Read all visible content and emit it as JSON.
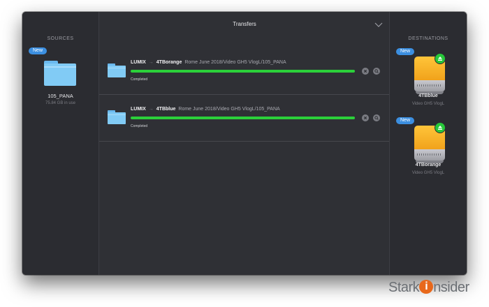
{
  "window": {
    "title": "Transfers",
    "sources_header": "SOURCES",
    "destinations_header": "DESTINATIONS"
  },
  "source": {
    "badge": "New",
    "name": "105_PANA",
    "usage": "75.84 GB in use"
  },
  "transfers": [
    {
      "source": "LUMIX",
      "arrow": "→",
      "destination": "4TBorange",
      "path": "Rome June 2018/Video GH5 VlogL/105_PANA",
      "status": "Completed",
      "progress": 1.0
    },
    {
      "source": "LUMIX",
      "arrow": "→",
      "destination": "4TBblue",
      "path": "Rome June 2018/Video GH5 VlogL/105_PANA",
      "status": "Completed",
      "progress": 1.0
    }
  ],
  "destinations": [
    {
      "badge": "New",
      "name": "4TBblue",
      "subtitle": "Video GH5 VlogL"
    },
    {
      "badge": "New",
      "name": "4TBorange",
      "subtitle": "Video GH5 VlogL"
    }
  ],
  "watermark": {
    "pre": "Stark",
    "dot": "i",
    "post": "nsider"
  },
  "colors": {
    "window_bg": "#2b2c31",
    "progress": "#2bd03a",
    "badge": "#3c8fe0",
    "folder": "#81cbf5",
    "drive": "#f1a21b",
    "eject": "#27c83a"
  },
  "icons": [
    "folder-icon",
    "chevron-down-icon",
    "cancel-icon",
    "magnifier-icon",
    "drive-icon",
    "eject-icon"
  ]
}
